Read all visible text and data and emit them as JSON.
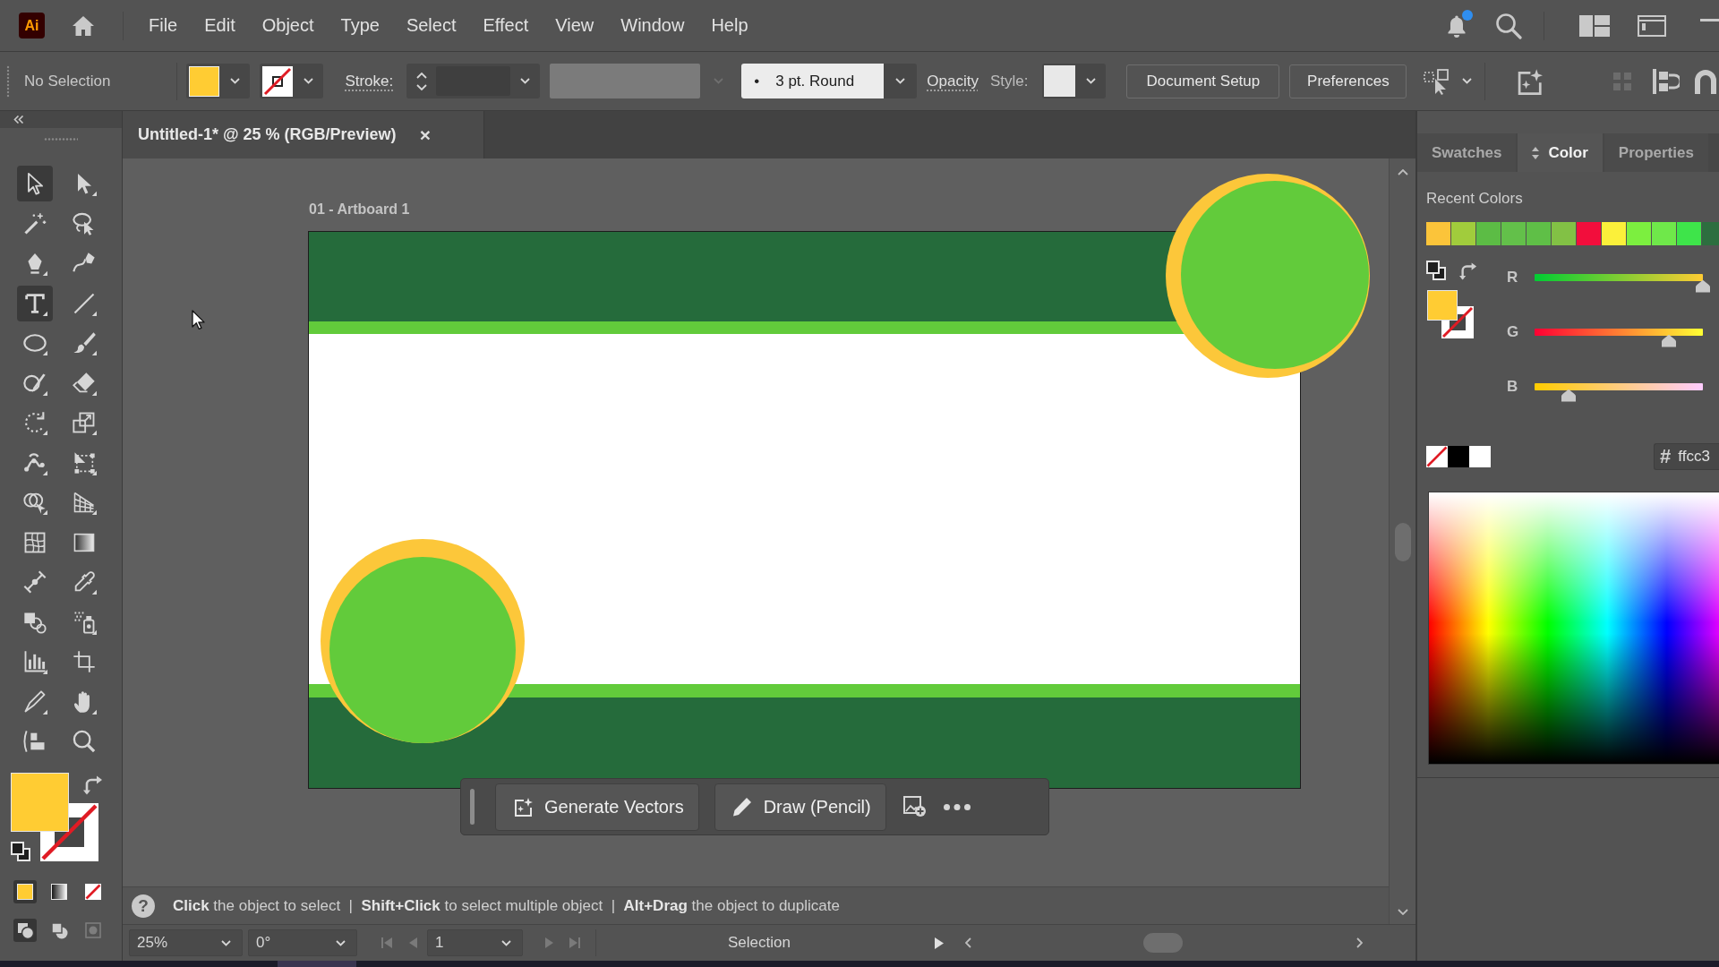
{
  "menu_bar": {
    "logo": "Ai",
    "menus": [
      "File",
      "Edit",
      "Object",
      "Type",
      "Select",
      "Effect",
      "View",
      "Window",
      "Help"
    ],
    "notification_badge": true
  },
  "control_bar": {
    "selection": "No Selection",
    "stroke_label": "Stroke:",
    "brush": {
      "bullet": "•",
      "label": "3 pt. Round"
    },
    "opacity_label": "Opacity",
    "style_label": "Style:",
    "buttons": [
      "Document Setup",
      "Preferences"
    ]
  },
  "toolbar": {
    "tools": [
      {
        "kind": "selection",
        "flyout": false,
        "highlighted": true
      },
      {
        "kind": "direct_selection",
        "flyout": true,
        "highlighted": false
      },
      {
        "kind": "magic_wand",
        "flyout": false,
        "highlighted": false
      },
      {
        "kind": "lasso",
        "flyout": false,
        "highlighted": false
      },
      {
        "kind": "pen",
        "flyout": true,
        "highlighted": false
      },
      {
        "kind": "curvature",
        "flyout": false,
        "highlighted": false
      },
      {
        "kind": "type",
        "flyout": true,
        "highlighted": true
      },
      {
        "kind": "line",
        "flyout": true,
        "highlighted": false
      },
      {
        "kind": "ellipse",
        "flyout": true,
        "highlighted": false
      },
      {
        "kind": "paintbrush",
        "flyout": true,
        "highlighted": false
      },
      {
        "kind": "shaper",
        "flyout": true,
        "highlighted": false
      },
      {
        "kind": "eraser",
        "flyout": true,
        "highlighted": false
      },
      {
        "kind": "rotate",
        "flyout": true,
        "highlighted": false
      },
      {
        "kind": "scale",
        "flyout": true,
        "highlighted": false
      },
      {
        "kind": "puppet_warp",
        "flyout": true,
        "highlighted": false
      },
      {
        "kind": "free_transform",
        "flyout": true,
        "highlighted": false
      },
      {
        "kind": "shape_builder",
        "flyout": true,
        "highlighted": false
      },
      {
        "kind": "perspective_grid",
        "flyout": true,
        "highlighted": false
      },
      {
        "kind": "mesh",
        "flyout": false,
        "highlighted": false
      },
      {
        "kind": "gradient",
        "flyout": false,
        "highlighted": false
      },
      {
        "kind": "width",
        "flyout": false,
        "highlighted": false
      },
      {
        "kind": "eyedropper",
        "flyout": true,
        "highlighted": false
      },
      {
        "kind": "shapes",
        "flyout": false,
        "highlighted": false
      },
      {
        "kind": "symbol_sprayer",
        "flyout": true,
        "highlighted": false
      },
      {
        "kind": "graph",
        "flyout": true,
        "highlighted": false
      },
      {
        "kind": "artboard",
        "flyout": false,
        "highlighted": false
      },
      {
        "kind": "slice",
        "flyout": true,
        "highlighted": false
      },
      {
        "kind": "hand",
        "flyout": true,
        "highlighted": false
      },
      {
        "kind": "edit_toolbar",
        "flyout": false,
        "highlighted": false
      },
      {
        "kind": "zoom",
        "flyout": false,
        "highlighted": false
      }
    ],
    "fill_modes": [
      {
        "kind": "color",
        "selected": true
      },
      {
        "kind": "gradient",
        "selected": false
      },
      {
        "kind": "none",
        "selected": false
      }
    ],
    "draw_modes": [
      {
        "kind": "normal",
        "selected": true,
        "disabled": false
      },
      {
        "kind": "behind",
        "selected": false,
        "disabled": false
      },
      {
        "kind": "inside",
        "selected": false,
        "disabled": true
      }
    ]
  },
  "document": {
    "tab": {
      "title": "Untitled-1* @ 25 % (RGB/Preview)",
      "close": "×"
    },
    "artboard_label": "01 - Artboard 1",
    "task_bar": {
      "buttons": [
        {
          "kind": "generate",
          "label": "Generate Vectors"
        },
        {
          "kind": "pencil",
          "label": "Draw (Pencil)"
        }
      ]
    },
    "hint": {
      "help": "?",
      "text": "**Click** the object to select  |  **Shift+Click** to select multiple object  |  **Alt+Drag** the object to duplicate"
    }
  },
  "status_bar": {
    "zoom": "25%",
    "rotation": "0°",
    "artboard": "1",
    "tool": "Selection"
  },
  "color_panel": {
    "tabs": [
      {
        "label": "Swatches",
        "selected": false
      },
      {
        "label": "Color",
        "selected": true
      },
      {
        "label": "Properties",
        "selected": false
      }
    ],
    "recent_title": "Recent Colors",
    "recent_colors": [
      {
        "color": "#fbc43a"
      },
      {
        "color": "#a1cc3c"
      },
      {
        "color": "#5cbc45"
      },
      {
        "color": "#63c04a"
      },
      {
        "color": "#5fbf47"
      },
      {
        "color": "#82c145"
      },
      {
        "color": "#f20e3c"
      },
      {
        "color": "#fbf03a"
      },
      {
        "color": "#7cef3f"
      },
      {
        "color": "#6fe84a"
      },
      {
        "color": "#3ee44a"
      },
      {
        "color": "#2d6e3f"
      }
    ],
    "channels": [
      {
        "name": "R",
        "level": 1.0
      },
      {
        "name": "G",
        "level": 0.8
      },
      {
        "name": "B",
        "level": 0.2
      }
    ],
    "hash": "#",
    "hex": "ffcc3"
  }
}
